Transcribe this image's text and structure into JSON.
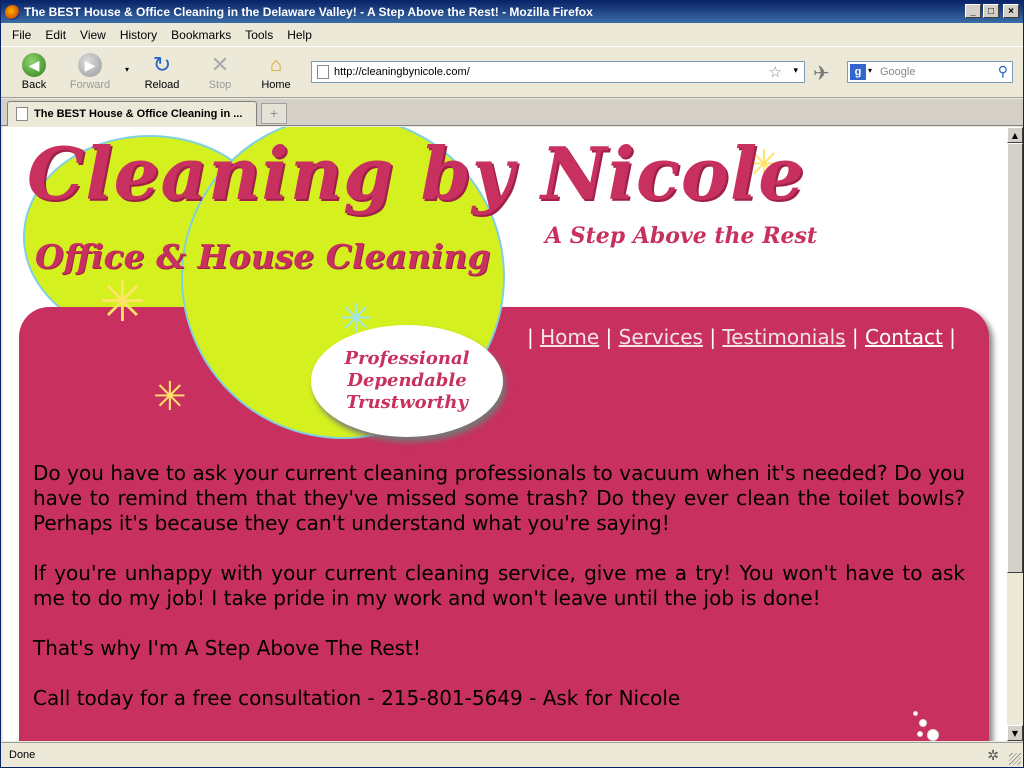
{
  "window": {
    "title": "The BEST House & Office Cleaning in the Delaware Valley! - A Step Above the Rest! - Mozilla Firefox"
  },
  "menu": [
    "File",
    "Edit",
    "View",
    "History",
    "Bookmarks",
    "Tools",
    "Help"
  ],
  "nav": {
    "back": "Back",
    "forward": "Forward",
    "reload": "Reload",
    "stop": "Stop",
    "home": "Home"
  },
  "url": "http://cleaningbynicole.com/",
  "search": {
    "placeholder": "Google"
  },
  "tab": {
    "title": "The BEST House & Office Cleaning in ..."
  },
  "status": "Done",
  "page": {
    "logo": "Cleaning by Nicole",
    "subtitle": "Office & House Cleaning",
    "tagline": "A Step Above the Rest",
    "oval": [
      "Professional",
      "Dependable",
      "Trustworthy"
    ],
    "menu": [
      {
        "label": "Home"
      },
      {
        "label": "Services"
      },
      {
        "label": "Testimonials"
      },
      {
        "label": "Contact"
      }
    ],
    "paragraphs": [
      "Do you have to ask your current cleaning professionals to vacuum when it's needed? Do you have to remind them that they've missed some trash? Do they ever clean the toilet bowls? Perhaps it's because they can't understand what you're saying!",
      "If you're unhappy with your current cleaning service, give me a try! You won't have to ask me to do my job! I take pride in my work and won't leave until the job is done!",
      "That's why I'm A Step Above The Rest!",
      "Call today for a free consultation - 215-801-5649 - Ask for Nicole"
    ]
  }
}
